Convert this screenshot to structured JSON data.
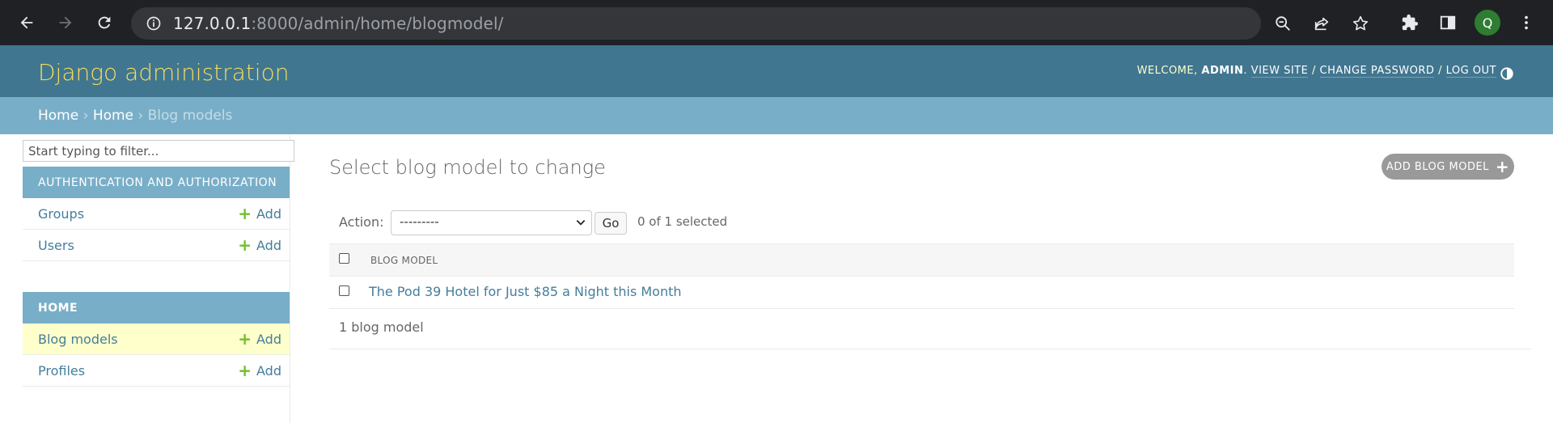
{
  "browser": {
    "url_host": "127.0.0.1",
    "url_rest": ":8000/admin/home/blogmodel/",
    "profile_initial": "Q"
  },
  "header": {
    "site_name": "Django administration",
    "welcome": "Welcome,",
    "username": "admin",
    "view_site": "View site",
    "change_password": "Change password",
    "log_out": "Log out"
  },
  "breadcrumbs": {
    "home": "Home",
    "app": "Home",
    "current": "Blog models"
  },
  "sidebar": {
    "filter_placeholder": "Start typing to filter...",
    "modules": [
      {
        "caption": "Authentication and Authorization",
        "models": [
          {
            "name": "Groups",
            "add": "Add"
          },
          {
            "name": "Users",
            "add": "Add"
          }
        ]
      },
      {
        "caption": "Home",
        "models": [
          {
            "name": "Blog models",
            "add": "Add"
          },
          {
            "name": "Profiles",
            "add": "Add"
          }
        ]
      }
    ]
  },
  "main": {
    "title": "Select blog model to change",
    "add_button": "Add blog model",
    "action_label": "Action:",
    "action_selected": "---------",
    "go_button": "Go",
    "selection_counter": "0 of 1 selected",
    "column_header": "Blog model",
    "rows": [
      {
        "title": "The Pod 39 Hotel for Just $85 a Night this Month"
      }
    ],
    "result_count": "1 blog model"
  },
  "colors": {
    "header_bg": "#417690",
    "breadcrumb_bg": "#79aec8",
    "site_name": "#f5dd5d",
    "link": "#447e9b",
    "add_plus": "#70bf2b",
    "current_row": "#ffffcc"
  }
}
